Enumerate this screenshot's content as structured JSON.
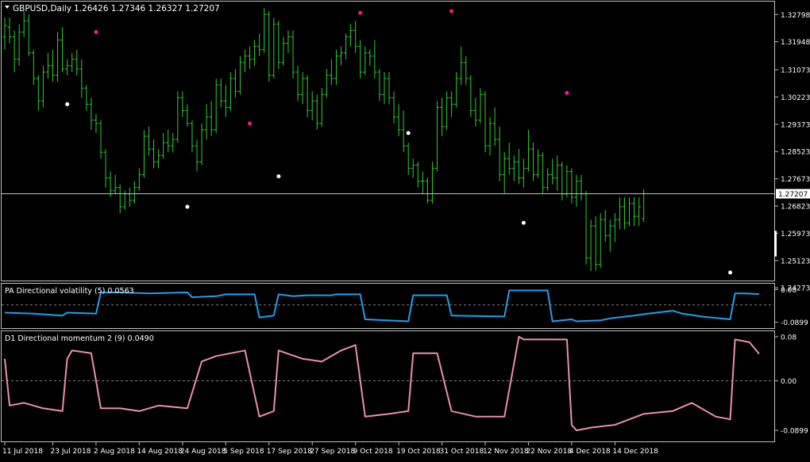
{
  "header": {
    "symbol": "GBPUSD,Daily",
    "ohlc": "1.26426 1.27346 1.26327 1.27207"
  },
  "colors": {
    "background": "#000000",
    "bar": "#32cd32",
    "frame": "#c0c0c0",
    "volatility_line": "#1e9ff2",
    "momentum_line": "#ee8fa8",
    "magenta_dot": "#ff1493",
    "white_dot": "#ffffff",
    "current_price_line": "#c0c0c0",
    "zero_line": "#808080"
  },
  "chart_data": [
    {
      "type": "ohlc",
      "title": "GBPUSD,Daily",
      "ylim": [
        1.245,
        1.332
      ],
      "yticks": [
        "1.32798",
        "1.31948",
        "1.31073",
        "1.30223",
        "1.29373",
        "1.28523",
        "1.27673",
        "1.26823",
        "1.25973",
        "1.25123",
        "1.24273"
      ],
      "current_price": 1.27207,
      "current_price_label": "1.27207",
      "x_labels": [
        "11 Jul 2018",
        "23 Jul 2018",
        "2 Aug 2018",
        "14 Aug 2018",
        "24 Aug 2018",
        "5 Sep 2018",
        "17 Sep 2018",
        "27 Sep 2018",
        "9 Oct 2018",
        "19 Oct 2018",
        "31 Oct 2018",
        "12 Nov 2018",
        "22 Nov 2018",
        "4 Dec 2018",
        "14 Dec 2018"
      ],
      "bars": [
        [
          1.321,
          1.327,
          1.317,
          1.3245
        ],
        [
          1.324,
          1.327,
          1.319,
          1.321
        ],
        [
          1.321,
          1.323,
          1.31,
          1.314
        ],
        [
          1.314,
          1.325,
          1.312,
          1.3225
        ],
        [
          1.3225,
          1.329,
          1.321,
          1.326
        ],
        [
          1.326,
          1.328,
          1.315,
          1.316
        ],
        [
          1.316,
          1.317,
          1.306,
          1.308
        ],
        [
          1.308,
          1.309,
          1.298,
          1.301
        ],
        [
          1.301,
          1.312,
          1.299,
          1.31
        ],
        [
          1.31,
          1.316,
          1.308,
          1.312
        ],
        [
          1.312,
          1.317,
          1.307,
          1.309
        ],
        [
          1.309,
          1.3225,
          1.307,
          1.32
        ],
        [
          1.32,
          1.324,
          1.31,
          1.311
        ],
        [
          1.311,
          1.314,
          1.309,
          1.312
        ],
        [
          1.312,
          1.316,
          1.31,
          1.314
        ],
        [
          1.314,
          1.317,
          1.309,
          1.311
        ],
        [
          1.311,
          1.314,
          1.302,
          1.305
        ],
        [
          1.305,
          1.306,
          1.298,
          1.3
        ],
        [
          1.3,
          1.302,
          1.292,
          1.295
        ],
        [
          1.295,
          1.297,
          1.291,
          1.294
        ],
        [
          1.294,
          1.295,
          1.283,
          1.285
        ],
        [
          1.285,
          1.286,
          1.274,
          1.277
        ],
        [
          1.277,
          1.279,
          1.271,
          1.273
        ],
        [
          1.273,
          1.278,
          1.272,
          1.274
        ],
        [
          1.274,
          1.275,
          1.266,
          1.268
        ],
        [
          1.268,
          1.273,
          1.267,
          1.272
        ],
        [
          1.272,
          1.274,
          1.268,
          1.27
        ],
        [
          1.27,
          1.276,
          1.269,
          1.274
        ],
        [
          1.274,
          1.28,
          1.273,
          1.278
        ],
        [
          1.278,
          1.292,
          1.277,
          1.29
        ],
        [
          1.29,
          1.293,
          1.284,
          1.286
        ],
        [
          1.286,
          1.289,
          1.28,
          1.282
        ],
        [
          1.282,
          1.286,
          1.28,
          1.284
        ],
        [
          1.284,
          1.291,
          1.283,
          1.288
        ],
        [
          1.288,
          1.292,
          1.285,
          1.287
        ],
        [
          1.287,
          1.291,
          1.285,
          1.289
        ],
        [
          1.289,
          1.304,
          1.288,
          1.302
        ],
        [
          1.302,
          1.304,
          1.296,
          1.298
        ],
        [
          1.298,
          1.3,
          1.293,
          1.294
        ],
        [
          1.294,
          1.295,
          1.285,
          1.287
        ],
        [
          1.287,
          1.289,
          1.279,
          1.282
        ],
        [
          1.282,
          1.294,
          1.281,
          1.292
        ],
        [
          1.292,
          1.3,
          1.289,
          1.296
        ],
        [
          1.296,
          1.301,
          1.29,
          1.292
        ],
        [
          1.292,
          1.308,
          1.291,
          1.306
        ],
        [
          1.306,
          1.308,
          1.299,
          1.301
        ],
        [
          1.301,
          1.306,
          1.296,
          1.299
        ],
        [
          1.299,
          1.31,
          1.298,
          1.308
        ],
        [
          1.308,
          1.311,
          1.302,
          1.304
        ],
        [
          1.304,
          1.315,
          1.303,
          1.313
        ],
        [
          1.313,
          1.317,
          1.31,
          1.315
        ],
        [
          1.315,
          1.318,
          1.311,
          1.314
        ],
        [
          1.314,
          1.32,
          1.312,
          1.318
        ],
        [
          1.318,
          1.322,
          1.315,
          1.317
        ],
        [
          1.317,
          1.33,
          1.316,
          1.328
        ],
        [
          1.328,
          1.329,
          1.307,
          1.309
        ],
        [
          1.309,
          1.327,
          1.308,
          1.325
        ],
        [
          1.325,
          1.326,
          1.311,
          1.313
        ],
        [
          1.313,
          1.321,
          1.312,
          1.319
        ],
        [
          1.319,
          1.323,
          1.316,
          1.321
        ],
        [
          1.321,
          1.323,
          1.308,
          1.31
        ],
        [
          1.31,
          1.312,
          1.301,
          1.303
        ],
        [
          1.303,
          1.31,
          1.3,
          1.308
        ],
        [
          1.308,
          1.309,
          1.296,
          1.298
        ],
        [
          1.298,
          1.304,
          1.295,
          1.301
        ],
        [
          1.301,
          1.303,
          1.292,
          1.294
        ],
        [
          1.294,
          1.305,
          1.293,
          1.303
        ],
        [
          1.303,
          1.311,
          1.302,
          1.309
        ],
        [
          1.309,
          1.314,
          1.306,
          1.308
        ],
        [
          1.308,
          1.317,
          1.306,
          1.315
        ],
        [
          1.315,
          1.318,
          1.312,
          1.316
        ],
        [
          1.316,
          1.322,
          1.314,
          1.321
        ],
        [
          1.321,
          1.325,
          1.318,
          1.323
        ],
        [
          1.323,
          1.326,
          1.316,
          1.318
        ],
        [
          1.318,
          1.32,
          1.308,
          1.31
        ],
        [
          1.31,
          1.318,
          1.309,
          1.316
        ],
        [
          1.316,
          1.317,
          1.312,
          1.315
        ],
        [
          1.315,
          1.32,
          1.308,
          1.31
        ],
        [
          1.31,
          1.311,
          1.301,
          1.303
        ],
        [
          1.303,
          1.31,
          1.3,
          1.308
        ],
        [
          1.308,
          1.31,
          1.3,
          1.302
        ],
        [
          1.302,
          1.304,
          1.294,
          1.296
        ],
        [
          1.296,
          1.3,
          1.29,
          1.292
        ],
        [
          1.292,
          1.298,
          1.285,
          1.287
        ],
        [
          1.287,
          1.288,
          1.278,
          1.28
        ],
        [
          1.28,
          1.283,
          1.277,
          1.281
        ],
        [
          1.281,
          1.282,
          1.274,
          1.276
        ],
        [
          1.276,
          1.279,
          1.272,
          1.276
        ],
        [
          1.276,
          1.277,
          1.269,
          1.27
        ],
        [
          1.27,
          1.282,
          1.269,
          1.28
        ],
        [
          1.28,
          1.301,
          1.279,
          1.299
        ],
        [
          1.299,
          1.302,
          1.29,
          1.293
        ],
        [
          1.293,
          1.304,
          1.292,
          1.302
        ],
        [
          1.302,
          1.304,
          1.296,
          1.3
        ],
        [
          1.3,
          1.31,
          1.299,
          1.308
        ],
        [
          1.308,
          1.318,
          1.306,
          1.313
        ],
        [
          1.313,
          1.315,
          1.306,
          1.308
        ],
        [
          1.308,
          1.309,
          1.296,
          1.298
        ],
        [
          1.298,
          1.302,
          1.293,
          1.295
        ],
        [
          1.295,
          1.305,
          1.294,
          1.303
        ],
        [
          1.303,
          1.304,
          1.285,
          1.287
        ],
        [
          1.287,
          1.296,
          1.284,
          1.294
        ],
        [
          1.294,
          1.299,
          1.287,
          1.289
        ],
        [
          1.289,
          1.293,
          1.276,
          1.278
        ],
        [
          1.278,
          1.285,
          1.272,
          1.283
        ],
        [
          1.283,
          1.288,
          1.278,
          1.28
        ],
        [
          1.28,
          1.284,
          1.276,
          1.282
        ],
        [
          1.282,
          1.286,
          1.275,
          1.277
        ],
        [
          1.277,
          1.283,
          1.274,
          1.28
        ],
        [
          1.28,
          1.292,
          1.279,
          1.286
        ],
        [
          1.286,
          1.288,
          1.276,
          1.278
        ],
        [
          1.278,
          1.286,
          1.277,
          1.284
        ],
        [
          1.284,
          1.285,
          1.272,
          1.274
        ],
        [
          1.274,
          1.28,
          1.273,
          1.278
        ],
        [
          1.278,
          1.283,
          1.275,
          1.277
        ],
        [
          1.277,
          1.284,
          1.273,
          1.281
        ],
        [
          1.281,
          1.282,
          1.27,
          1.272
        ],
        [
          1.272,
          1.281,
          1.271,
          1.279
        ],
        [
          1.279,
          1.28,
          1.269,
          1.271
        ],
        [
          1.271,
          1.278,
          1.268,
          1.276
        ],
        [
          1.276,
          1.278,
          1.27,
          1.272
        ],
        [
          1.272,
          1.273,
          1.25,
          1.252
        ],
        [
          1.252,
          1.264,
          1.248,
          1.262
        ],
        [
          1.262,
          1.265,
          1.248,
          1.25
        ],
        [
          1.25,
          1.266,
          1.249,
          1.264
        ],
        [
          1.264,
          1.267,
          1.257,
          1.259
        ],
        [
          1.259,
          1.264,
          1.254,
          1.262
        ],
        [
          1.262,
          1.266,
          1.257,
          1.264
        ],
        [
          1.264,
          1.271,
          1.261,
          1.268
        ],
        [
          1.268,
          1.271,
          1.261,
          1.263
        ],
        [
          1.263,
          1.271,
          1.262,
          1.269
        ],
        [
          1.269,
          1.271,
          1.262,
          1.265
        ],
        [
          1.265,
          1.271,
          1.262,
          1.268
        ],
        [
          1.2643,
          1.2735,
          1.2633,
          1.2721
        ]
      ],
      "magenta_dots": [
        [
          19,
          1.3225
        ],
        [
          51,
          1.294
        ],
        [
          74,
          1.3285
        ],
        [
          93,
          1.329
        ],
        [
          117,
          1.3035
        ]
      ],
      "white_dots": [
        [
          13,
          1.3
        ],
        [
          38,
          1.268
        ],
        [
          57,
          1.2775
        ],
        [
          84,
          1.291
        ],
        [
          108,
          1.263
        ],
        [
          151,
          1.2475
        ]
      ]
    },
    {
      "type": "line",
      "title": "PA Directional volatility (5) 0.0563",
      "ylim": [
        -0.12,
        0.11
      ],
      "ytick_labels": [
        "0.08",
        "-0.0899"
      ],
      "yticks": [
        0.08,
        -0.0899
      ],
      "zero_line": 0.0,
      "x": [
        0,
        6,
        12,
        13,
        19,
        20,
        24,
        30,
        38,
        39,
        44,
        46,
        52,
        53,
        56,
        57,
        60,
        63,
        68,
        69,
        74,
        75,
        84,
        85,
        92,
        93,
        104,
        105,
        113,
        114,
        118,
        119,
        124,
        126,
        131,
        134,
        139,
        141,
        145,
        151,
        152,
        154,
        157
      ],
      "values": [
        -0.04,
        -0.045,
        -0.055,
        -0.04,
        -0.045,
        0.065,
        0.065,
        0.06,
        0.065,
        0.04,
        0.045,
        0.055,
        0.055,
        -0.065,
        -0.055,
        0.055,
        0.045,
        0.05,
        0.05,
        0.055,
        0.055,
        -0.075,
        -0.085,
        0.05,
        0.05,
        -0.055,
        -0.06,
        0.075,
        0.075,
        -0.085,
        -0.075,
        -0.085,
        -0.08,
        -0.07,
        -0.055,
        -0.045,
        -0.03,
        -0.045,
        -0.06,
        -0.075,
        0.06,
        0.06,
        0.0563
      ],
      "colors": [
        "#1e9ff2"
      ]
    },
    {
      "type": "line",
      "title": "D1 Directional momentum 2 (9) 0.0490",
      "ylim": [
        -0.11,
        0.09
      ],
      "ytick_labels": [
        "0.08",
        "0.00",
        "-0.0899"
      ],
      "yticks": [
        0.08,
        0.0,
        -0.0899
      ],
      "zero_line": 0.0,
      "x": [
        0,
        1,
        4,
        8,
        12,
        13,
        14,
        18,
        20,
        24,
        28,
        32,
        38,
        41,
        44,
        50,
        53,
        56,
        57,
        62,
        66,
        70,
        73,
        75,
        80,
        84,
        85,
        90,
        93,
        98,
        104,
        107,
        108,
        112,
        117,
        118,
        119,
        122,
        127,
        133,
        139,
        143,
        148,
        151,
        152,
        155,
        157
      ],
      "values": [
        0.04,
        -0.045,
        -0.04,
        -0.05,
        -0.055,
        0.04,
        0.055,
        0.05,
        -0.05,
        -0.05,
        -0.055,
        -0.045,
        -0.05,
        0.035,
        0.045,
        0.055,
        -0.065,
        -0.055,
        0.055,
        0.04,
        0.035,
        0.055,
        0.065,
        -0.065,
        -0.06,
        -0.055,
        0.05,
        0.05,
        -0.055,
        -0.065,
        -0.065,
        0.08,
        0.075,
        0.075,
        0.075,
        -0.08,
        -0.09,
        -0.085,
        -0.08,
        -0.06,
        -0.055,
        -0.04,
        -0.065,
        -0.07,
        0.075,
        0.07,
        0.049
      ],
      "colors": [
        "#ee8fa8"
      ]
    }
  ]
}
